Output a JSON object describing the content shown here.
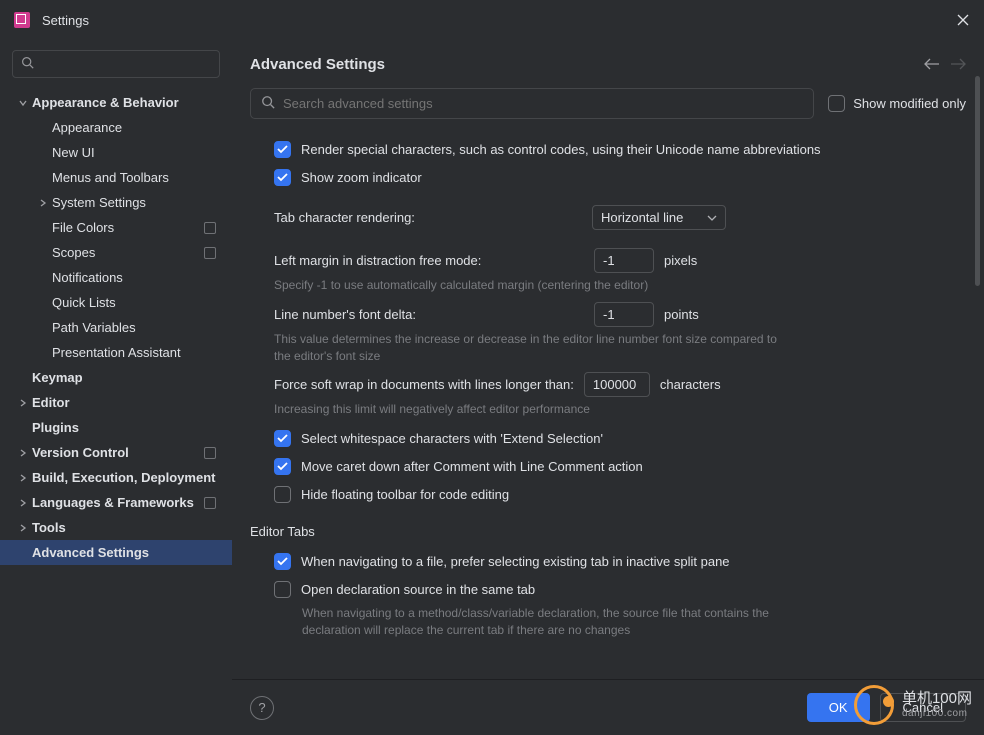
{
  "title": "Settings",
  "sidebar": {
    "items": [
      {
        "label": "Appearance & Behavior",
        "depth": 0,
        "expanded": true
      },
      {
        "label": "Appearance",
        "depth": 1
      },
      {
        "label": "New UI",
        "depth": 1
      },
      {
        "label": "Menus and Toolbars",
        "depth": 1
      },
      {
        "label": "System Settings",
        "depth": 1,
        "expandable": true
      },
      {
        "label": "File Colors",
        "depth": 1,
        "badge": true
      },
      {
        "label": "Scopes",
        "depth": 1,
        "badge": true
      },
      {
        "label": "Notifications",
        "depth": 1
      },
      {
        "label": "Quick Lists",
        "depth": 1
      },
      {
        "label": "Path Variables",
        "depth": 1
      },
      {
        "label": "Presentation Assistant",
        "depth": 1
      },
      {
        "label": "Keymap",
        "depth": 0,
        "noarrow": true
      },
      {
        "label": "Editor",
        "depth": 0,
        "expandable": true
      },
      {
        "label": "Plugins",
        "depth": 0,
        "noarrow": true
      },
      {
        "label": "Version Control",
        "depth": 0,
        "expandable": true,
        "badge": true
      },
      {
        "label": "Build, Execution, Deployment",
        "depth": 0,
        "expandable": true
      },
      {
        "label": "Languages & Frameworks",
        "depth": 0,
        "expandable": true,
        "badge": true
      },
      {
        "label": "Tools",
        "depth": 0,
        "expandable": true
      },
      {
        "label": "Advanced Settings",
        "depth": 0,
        "noarrow": true,
        "selected": true
      }
    ]
  },
  "main": {
    "title": "Advanced Settings",
    "search_placeholder": "Search advanced settings",
    "show_modified": "Show modified only",
    "opts": {
      "render_special": "Render special characters, such as control codes, using their Unicode name abbreviations",
      "show_zoom": "Show zoom indicator",
      "tab_char_label": "Tab character rendering:",
      "tab_char_value": "Horizontal line",
      "left_margin_label": "Left margin in distraction free mode:",
      "left_margin_value": "-1",
      "pixels": "pixels",
      "left_margin_hint": "Specify -1 to use automatically calculated margin (centering the editor)",
      "line_delta_label": "Line number's font delta:",
      "line_delta_value": "-1",
      "points": "points",
      "line_delta_hint": "This value determines the increase or decrease in the editor line number font size compared to the editor's font size",
      "force_wrap_label": "Force soft wrap in documents with lines longer than:",
      "force_wrap_value": "100000",
      "characters": "characters",
      "force_wrap_hint": "Increasing this limit will negatively affect editor performance",
      "select_ws": "Select whitespace characters with 'Extend Selection'",
      "move_caret": "Move caret down after Comment with Line Comment action",
      "hide_toolbar": "Hide floating toolbar for code editing",
      "editor_tabs": "Editor Tabs",
      "prefer_existing": "When navigating to a file, prefer selecting existing tab in inactive split pane",
      "open_decl": "Open declaration source in the same tab",
      "open_decl_hint": "When navigating to a method/class/variable declaration, the source file that contains the declaration will replace the current tab if there are no changes"
    }
  },
  "footer": {
    "ok": "OK",
    "cancel": "Cancel"
  },
  "watermark": {
    "cn": "单机100网",
    "url": "danji100.com"
  }
}
